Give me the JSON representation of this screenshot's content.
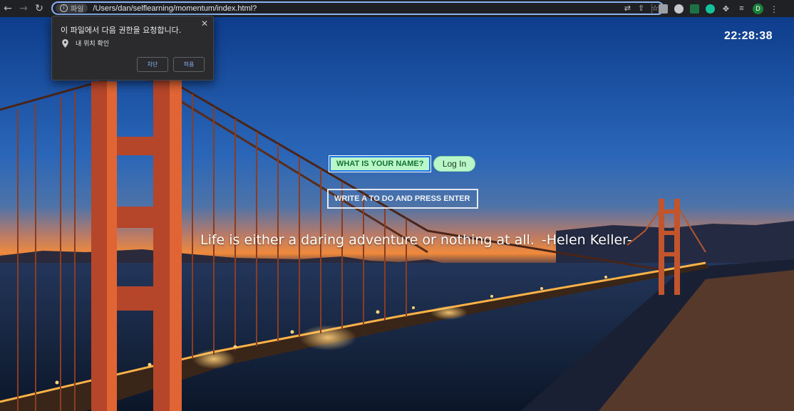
{
  "browser": {
    "site_chip_label": "파일",
    "url": "/Users/dan/selflearning/momentum/index.html?",
    "avatar_letter": "D"
  },
  "permission_popup": {
    "title": "이 파일에서 다음 권한을 요청합니다.",
    "permission_label": "내 위치 확인",
    "block_label": "차단",
    "allow_label": "허용"
  },
  "page": {
    "clock": "22:28:38",
    "name_placeholder": "WHAT IS YOUR NAME?",
    "login_label": "Log In",
    "todo_placeholder": "WRITE A TO DO AND PRESS ENTER",
    "quote_text": "Life is either a daring adventure or nothing at all.",
    "quote_author": "-Helen Keller-"
  },
  "colors": {
    "focus_ring": "#8ab4f8",
    "input_bg": "#b9f6c8",
    "input_text": "#137333"
  }
}
